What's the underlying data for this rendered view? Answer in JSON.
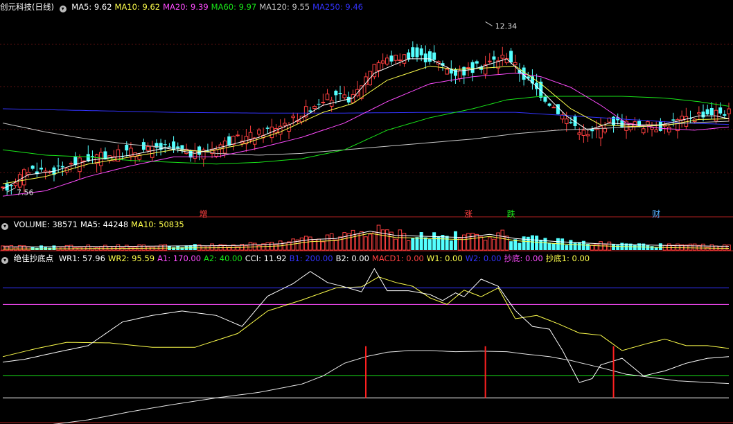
{
  "colors": {
    "up": "#ff4040",
    "down": "#54ffff",
    "ma5": "#ffffff",
    "ma10": "#ffff4c",
    "ma20": "#ff4cff",
    "ma60": "#19e619",
    "ma120": "#c8c8c8",
    "ma250": "#3333ff",
    "wr1": "#ffffff",
    "wr2": "#ffff4c",
    "a1": "#ff4cff",
    "a2": "#19e619",
    "b1": "#3333ff",
    "signal": "#ff2020"
  },
  "price_panel": {
    "title": "创元科技(日线)",
    "ma": [
      {
        "label": "MA5: 9.62",
        "color": "#ffffff"
      },
      {
        "label": "MA10: 9.62",
        "color": "#ffff4c"
      },
      {
        "label": "MA20: 9.39",
        "color": "#ff4cff"
      },
      {
        "label": "MA60: 9.97",
        "color": "#19e619"
      },
      {
        "label": "MA120: 9.55",
        "color": "#c8c8c8"
      },
      {
        "label": "MA250: 9.46",
        "color": "#3333ff"
      }
    ],
    "high_label": "12.34",
    "low_label": "7.56",
    "events": [
      {
        "label": "增",
        "color": "#ff4040",
        "index": 47
      },
      {
        "label": "涨",
        "color": "#ff4040",
        "index": 109
      },
      {
        "label": "跌",
        "color": "#19e619",
        "index": 119
      },
      {
        "label": "财",
        "color": "#54b0ff",
        "index": 153
      }
    ]
  },
  "volume_panel": {
    "items": [
      {
        "label": "VOLUME: 38571",
        "color": "#ffffff"
      },
      {
        "label": "MA5: 44248",
        "color": "#ffffff"
      },
      {
        "label": "MA10: 50835",
        "color": "#ffff4c"
      }
    ]
  },
  "indicator_panel": {
    "title": "绝佳抄底点",
    "items": [
      {
        "label": "WR1: 57.96",
        "color": "#ffffff"
      },
      {
        "label": "WR2: 95.59",
        "color": "#ffff4c"
      },
      {
        "label": "A1: 170.00",
        "color": "#ff4cff"
      },
      {
        "label": "A2: 40.00",
        "color": "#19e619"
      },
      {
        "label": "CCI: 11.92",
        "color": "#ffffff"
      },
      {
        "label": "B1: 200.00",
        "color": "#3333ff"
      },
      {
        "label": "B2: 0.00",
        "color": "#ffffff"
      },
      {
        "label": "MACD1: 0.00",
        "color": "#ff4040"
      },
      {
        "label": "W1: 0.00",
        "color": "#ffff4c"
      },
      {
        "label": "W2: 0.00",
        "color": "#3333ff"
      },
      {
        "label": "抄底: 0.00",
        "color": "#ff4cff"
      },
      {
        "label": "抄底1: 0.00",
        "color": "#ffff4c"
      }
    ]
  },
  "chart_data": [
    {
      "type": "candlestick",
      "title": "创元科技(日线)",
      "ylim": [
        7.2,
        12.6
      ],
      "anchors": {
        "close": [
          [
            0,
            7.6
          ],
          [
            6,
            8.2
          ],
          [
            12,
            8.15
          ],
          [
            20,
            8.5
          ],
          [
            30,
            8.7
          ],
          [
            38,
            8.8
          ],
          [
            45,
            8.6
          ],
          [
            52,
            8.95
          ],
          [
            60,
            9.2
          ],
          [
            68,
            9.6
          ],
          [
            75,
            10.2
          ],
          [
            82,
            10.2
          ],
          [
            87,
            11.2
          ],
          [
            95,
            11.4
          ],
          [
            100,
            11.3
          ],
          [
            106,
            10.9
          ],
          [
            110,
            11.0
          ],
          [
            114,
            11.2
          ],
          [
            118,
            11.4
          ],
          [
            122,
            10.8
          ],
          [
            127,
            10.2
          ],
          [
            132,
            9.6
          ],
          [
            137,
            9.15
          ],
          [
            142,
            9.55
          ],
          [
            148,
            9.45
          ],
          [
            154,
            9.4
          ],
          [
            158,
            9.55
          ],
          [
            163,
            9.75
          ],
          [
            167,
            9.8
          ],
          [
            170,
            9.8
          ]
        ],
        "ma5": [
          [
            0,
            7.65
          ],
          [
            6,
            8.05
          ],
          [
            12,
            8.15
          ],
          [
            20,
            8.45
          ],
          [
            30,
            8.6
          ],
          [
            38,
            8.8
          ],
          [
            45,
            8.65
          ],
          [
            52,
            8.85
          ],
          [
            60,
            9.1
          ],
          [
            68,
            9.5
          ],
          [
            75,
            10.0
          ],
          [
            82,
            10.2
          ],
          [
            87,
            10.9
          ],
          [
            95,
            11.3
          ],
          [
            100,
            11.3
          ],
          [
            106,
            10.95
          ],
          [
            110,
            11.0
          ],
          [
            114,
            11.15
          ],
          [
            118,
            11.3
          ],
          [
            122,
            10.85
          ],
          [
            127,
            10.3
          ],
          [
            132,
            9.7
          ],
          [
            137,
            9.3
          ],
          [
            142,
            9.5
          ],
          [
            148,
            9.45
          ],
          [
            154,
            9.45
          ],
          [
            158,
            9.55
          ],
          [
            163,
            9.7
          ],
          [
            167,
            9.7
          ],
          [
            170,
            9.62
          ]
        ],
        "ma10": [
          [
            0,
            7.8
          ],
          [
            10,
            8.0
          ],
          [
            20,
            8.35
          ],
          [
            30,
            8.55
          ],
          [
            40,
            8.75
          ],
          [
            48,
            8.7
          ],
          [
            56,
            8.9
          ],
          [
            65,
            9.25
          ],
          [
            75,
            9.8
          ],
          [
            82,
            10.05
          ],
          [
            90,
            10.7
          ],
          [
            100,
            11.1
          ],
          [
            106,
            11.0
          ],
          [
            114,
            11.05
          ],
          [
            120,
            11.1
          ],
          [
            126,
            10.6
          ],
          [
            133,
            9.9
          ],
          [
            140,
            9.45
          ],
          [
            148,
            9.4
          ],
          [
            156,
            9.45
          ],
          [
            163,
            9.6
          ],
          [
            170,
            9.62
          ]
        ],
        "ma20": [
          [
            0,
            7.45
          ],
          [
            10,
            7.6
          ],
          [
            20,
            8.0
          ],
          [
            30,
            8.3
          ],
          [
            40,
            8.55
          ],
          [
            50,
            8.55
          ],
          [
            60,
            8.8
          ],
          [
            70,
            9.1
          ],
          [
            80,
            9.5
          ],
          [
            90,
            10.1
          ],
          [
            100,
            10.6
          ],
          [
            110,
            10.8
          ],
          [
            120,
            10.9
          ],
          [
            126,
            10.8
          ],
          [
            133,
            10.5
          ],
          [
            140,
            10.0
          ],
          [
            146,
            9.5
          ],
          [
            154,
            9.35
          ],
          [
            162,
            9.3
          ],
          [
            170,
            9.39
          ]
        ],
        "ma60": [
          [
            0,
            8.75
          ],
          [
            10,
            8.6
          ],
          [
            20,
            8.55
          ],
          [
            30,
            8.45
          ],
          [
            40,
            8.4
          ],
          [
            50,
            8.35
          ],
          [
            60,
            8.4
          ],
          [
            70,
            8.5
          ],
          [
            80,
            8.75
          ],
          [
            90,
            9.3
          ],
          [
            100,
            9.65
          ],
          [
            110,
            9.9
          ],
          [
            118,
            10.15
          ],
          [
            126,
            10.25
          ],
          [
            135,
            10.25
          ],
          [
            145,
            10.25
          ],
          [
            155,
            10.2
          ],
          [
            163,
            10.1
          ],
          [
            170,
            9.97
          ]
        ],
        "ma120": [
          [
            0,
            9.5
          ],
          [
            10,
            9.25
          ],
          [
            20,
            9.05
          ],
          [
            30,
            8.9
          ],
          [
            40,
            8.8
          ],
          [
            50,
            8.65
          ],
          [
            60,
            8.6
          ],
          [
            70,
            8.65
          ],
          [
            80,
            8.75
          ],
          [
            90,
            8.85
          ],
          [
            100,
            8.95
          ],
          [
            110,
            9.05
          ],
          [
            120,
            9.2
          ],
          [
            130,
            9.3
          ],
          [
            140,
            9.35
          ],
          [
            150,
            9.4
          ],
          [
            160,
            9.5
          ],
          [
            170,
            9.55
          ]
        ],
        "ma250": [
          [
            0,
            9.9
          ],
          [
            20,
            9.85
          ],
          [
            40,
            9.8
          ],
          [
            60,
            9.78
          ],
          [
            80,
            9.78
          ],
          [
            100,
            9.8
          ],
          [
            120,
            9.8
          ],
          [
            140,
            9.65
          ],
          [
            160,
            9.5
          ],
          [
            170,
            9.46
          ]
        ]
      }
    },
    {
      "type": "bar",
      "title": "VOLUME",
      "anchors": {
        "volume": [
          [
            0,
            0.15
          ],
          [
            30,
            0.18
          ],
          [
            55,
            0.22
          ],
          [
            65,
            0.3
          ],
          [
            72,
            0.5
          ],
          [
            78,
            0.55
          ],
          [
            86,
            0.9
          ],
          [
            92,
            0.7
          ],
          [
            100,
            0.65
          ],
          [
            108,
            0.6
          ],
          [
            114,
            0.75
          ],
          [
            120,
            0.55
          ],
          [
            130,
            0.4
          ],
          [
            140,
            0.3
          ],
          [
            155,
            0.22
          ],
          [
            170,
            0.18
          ]
        ]
      }
    },
    {
      "type": "line",
      "title": "绝佳抄底点",
      "ylim": [
        -40,
        260
      ],
      "reference_lines": {
        "B1": 200,
        "A1": 170,
        "A2": 40,
        "zero": 0
      },
      "anchors": {
        "wr1": [
          [
            0,
            65
          ],
          [
            5,
            70
          ],
          [
            12,
            82
          ],
          [
            20,
            95
          ],
          [
            28,
            138
          ],
          [
            35,
            150
          ],
          [
            42,
            158
          ],
          [
            50,
            150
          ],
          [
            56,
            130
          ],
          [
            62,
            185
          ],
          [
            68,
            208
          ],
          [
            72,
            230
          ],
          [
            76,
            210
          ],
          [
            80,
            202
          ],
          [
            84,
            193
          ],
          [
            87,
            235
          ],
          [
            90,
            195
          ],
          [
            95,
            195
          ],
          [
            100,
            188
          ],
          [
            103,
            177
          ],
          [
            106,
            191
          ],
          [
            108,
            184
          ],
          [
            112,
            216
          ],
          [
            116,
            203
          ],
          [
            120,
            159
          ],
          [
            124,
            130
          ],
          [
            128,
            125
          ],
          [
            131,
            87
          ],
          [
            135,
            28
          ],
          [
            138,
            35
          ],
          [
            140,
            60
          ],
          [
            145,
            72
          ],
          [
            150,
            40
          ],
          [
            155,
            49
          ],
          [
            160,
            63
          ],
          [
            165,
            72
          ],
          [
            170,
            75
          ]
        ],
        "wr2": [
          [
            0,
            75
          ],
          [
            8,
            90
          ],
          [
            15,
            101
          ],
          [
            25,
            100
          ],
          [
            35,
            92
          ],
          [
            45,
            92
          ],
          [
            55,
            117
          ],
          [
            62,
            158
          ],
          [
            70,
            178
          ],
          [
            78,
            200
          ],
          [
            84,
            202
          ],
          [
            88,
            220
          ],
          [
            92,
            210
          ],
          [
            96,
            203
          ],
          [
            100,
            182
          ],
          [
            104,
            170
          ],
          [
            108,
            196
          ],
          [
            112,
            184
          ],
          [
            116,
            200
          ],
          [
            120,
            144
          ],
          [
            125,
            150
          ],
          [
            130,
            135
          ],
          [
            135,
            118
          ],
          [
            140,
            114
          ],
          [
            145,
            86
          ],
          [
            150,
            97
          ],
          [
            155,
            107
          ],
          [
            160,
            95
          ],
          [
            165,
            95
          ],
          [
            170,
            90
          ]
        ],
        "cci": [
          [
            0,
            -58
          ],
          [
            10,
            -50
          ],
          [
            20,
            -40
          ],
          [
            30,
            -25
          ],
          [
            40,
            -12
          ],
          [
            50,
            0
          ],
          [
            60,
            10
          ],
          [
            70,
            25
          ],
          [
            75,
            40
          ],
          [
            80,
            63
          ],
          [
            85,
            75
          ],
          [
            90,
            83
          ],
          [
            95,
            86
          ],
          [
            100,
            86
          ],
          [
            106,
            84
          ],
          [
            112,
            85
          ],
          [
            118,
            84
          ],
          [
            122,
            80
          ],
          [
            128,
            75
          ],
          [
            133,
            68
          ],
          [
            140,
            55
          ],
          [
            146,
            43
          ],
          [
            152,
            37
          ],
          [
            158,
            31
          ],
          [
            165,
            28
          ],
          [
            170,
            26
          ]
        ],
        "signal_bars": [
          {
            "index": 85,
            "value": 40
          },
          {
            "index": 113,
            "value": 40
          },
          {
            "index": 143,
            "value": 40
          }
        ]
      }
    }
  ]
}
